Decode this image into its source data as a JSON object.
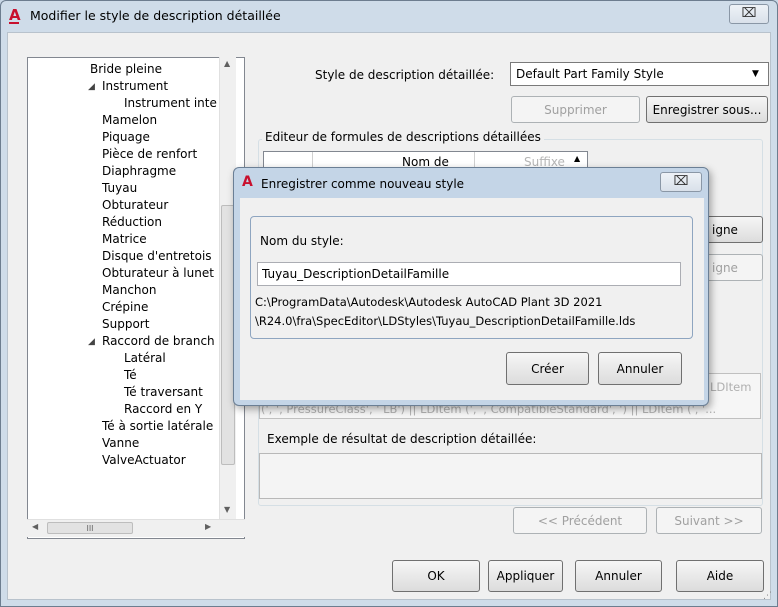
{
  "window": {
    "title": "Modifier le style de description détaillée",
    "close_glyph": "⌧"
  },
  "tree": {
    "items": [
      {
        "label": "Bride pleine"
      },
      {
        "label": "Instrument"
      },
      {
        "label": "Instrument inte"
      },
      {
        "label": "Mamelon"
      },
      {
        "label": "Piquage"
      },
      {
        "label": "Pièce de renfort"
      },
      {
        "label": "Diaphragme"
      },
      {
        "label": "Tuyau"
      },
      {
        "label": "Obturateur"
      },
      {
        "label": "Réduction"
      },
      {
        "label": "Matrice"
      },
      {
        "label": "Disque d'entretois"
      },
      {
        "label": "Obturateur à lunet"
      },
      {
        "label": "Manchon"
      },
      {
        "label": "Crépine"
      },
      {
        "label": "Support"
      },
      {
        "label": "Raccord de branch"
      },
      {
        "label": "Latéral"
      },
      {
        "label": "Té"
      },
      {
        "label": "Té traversant"
      },
      {
        "label": "Raccord en Y"
      },
      {
        "label": "Té à sortie latérale"
      },
      {
        "label": "Vanne"
      },
      {
        "label": "ValveActuator"
      }
    ],
    "hscroll_thumb": "III"
  },
  "style_select": {
    "label": "Style de description détaillée:",
    "value": "Default Part Family Style"
  },
  "buttons": {
    "supprimer": "Supprimer",
    "enregistrer_sous": "Enregistrer sous...",
    "ligne1": "igne",
    "ligne2": "igne",
    "precedent": "<< Précédent",
    "suivant": "Suivant >>",
    "ok": "OK",
    "appliquer": "Appliquer",
    "annuler": "Annuler",
    "aide": "Aide"
  },
  "editor": {
    "group_label": "Editeur de formules de descriptions détaillées",
    "col_header": "Nom de",
    "faded_col": "Suffixe",
    "formula_line1": "LDItem",
    "formula_line2": "(', ', PressureClass', ' LB') || LDItem (', ', CompatibleStandard', ') || LDItem (', '..."
  },
  "example": {
    "label": "Exemple de résultat de description détaillée:",
    "value": ""
  },
  "modal": {
    "title": "Enregistrer comme nouveau style",
    "close_glyph": "⌧",
    "name_label": "Nom du style:",
    "name_value": "Tuyau_DescriptionDetailFamille",
    "path_line1": "C:\\ProgramData\\Autodesk\\Autodesk AutoCAD Plant 3D 2021",
    "path_line2": "\\R24.0\\fra\\SpecEditor\\LDStyles\\Tuyau_DescriptionDetailFamille.lds",
    "create": "Créer",
    "cancel": "Annuler"
  }
}
